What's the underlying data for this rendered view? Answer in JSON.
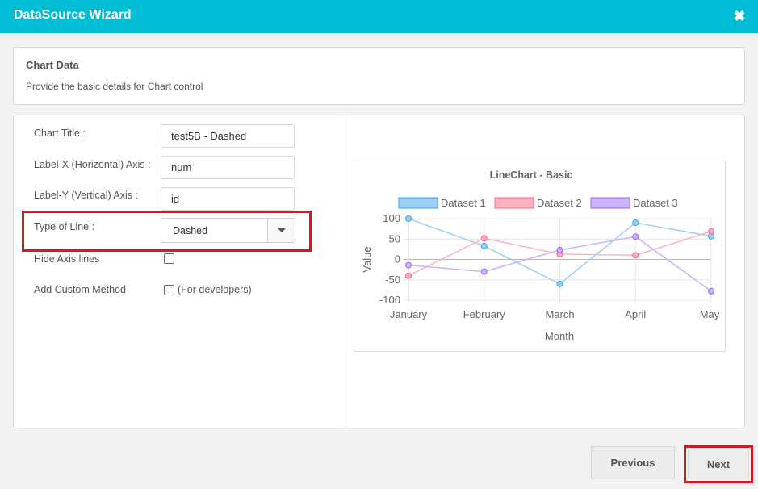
{
  "dialog": {
    "title": "DataSource Wizard",
    "close_icon": "close-icon"
  },
  "header": {
    "title": "Chart Data",
    "subtitle": "Provide the basic details for Chart control"
  },
  "form": {
    "chart_title": {
      "label": "Chart Title :",
      "value": "test5B - Dashed"
    },
    "label_x": {
      "label": "Label-X (Horizontal) Axis :",
      "value": "num"
    },
    "label_y": {
      "label": "Label-Y (Vertical) Axis :",
      "value": "id"
    },
    "type_of_line": {
      "label": "Type of Line :",
      "value": "Dashed"
    },
    "hide_axis": {
      "label": "Hide Axis lines",
      "checked": false
    },
    "custom_method": {
      "label": "Add Custom Method",
      "note": "(For developers)",
      "checked": false
    }
  },
  "chart_data": {
    "type": "line",
    "title": "LineChart - Basic",
    "xlabel": "Month",
    "ylabel": "Value",
    "categories": [
      "January",
      "February",
      "March",
      "April",
      "May"
    ],
    "ylim": [
      -100,
      100
    ],
    "yticks": [
      100,
      50,
      0,
      -50,
      -100
    ],
    "grid": true,
    "legend": "top",
    "series": [
      {
        "name": "Dataset 1",
        "values": [
          100,
          33,
          -60,
          90,
          57
        ],
        "color": "#36a2eb",
        "fill": "#9ad0f5"
      },
      {
        "name": "Dataset 2",
        "values": [
          -40,
          52,
          13,
          10,
          69
        ],
        "color": "#ff6384",
        "fill": "#ffb1c1"
      },
      {
        "name": "Dataset 3",
        "values": [
          -14,
          -30,
          23,
          56,
          -78
        ],
        "color": "#9966ff",
        "fill": "#ccb2ff"
      }
    ]
  },
  "footer": {
    "previous_label": "Previous",
    "next_label": "Next"
  },
  "colors": {
    "accent": "#00bcd4",
    "highlight": "#e0141e"
  }
}
